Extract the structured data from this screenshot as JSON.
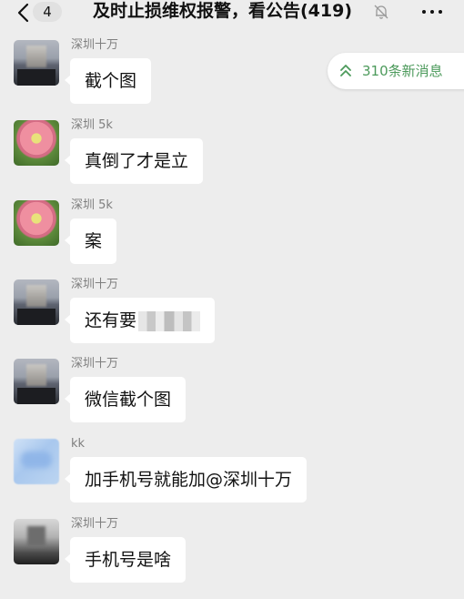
{
  "header": {
    "back_icon": "chevron-left-icon",
    "unread_count": "4",
    "title": "及时止损维权报警，看公告(419)",
    "mute_icon": "bell-mute-icon",
    "more_icon": "more-icon"
  },
  "new_messages": {
    "label": "310条新消息",
    "icon": "double-chevron-up-icon",
    "color": "#4c9a5b"
  },
  "messages": [
    {
      "sender": "深圳十万",
      "text": "截个图",
      "avatar": "avatar-dark"
    },
    {
      "sender": "深圳 5k",
      "text": "真倒了才是立",
      "avatar": "avatar-flower"
    },
    {
      "sender": "深圳 5k",
      "text": "案",
      "avatar": "avatar-flower"
    },
    {
      "sender": "深圳十万",
      "text": "还有要",
      "avatar": "avatar-dark"
    },
    {
      "sender": "深圳十万",
      "text": "微信截个图",
      "avatar": "avatar-dark"
    },
    {
      "sender": "kk",
      "text": "加手机号就能加@深圳十万",
      "avatar": "avatar-blue"
    },
    {
      "sender": "深圳十万",
      "text": "手机号是啥",
      "avatar": "avatar-mono"
    }
  ],
  "colors": {
    "background": "#ededed",
    "bubble": "#ffffff",
    "sender": "#7f7f7f"
  }
}
